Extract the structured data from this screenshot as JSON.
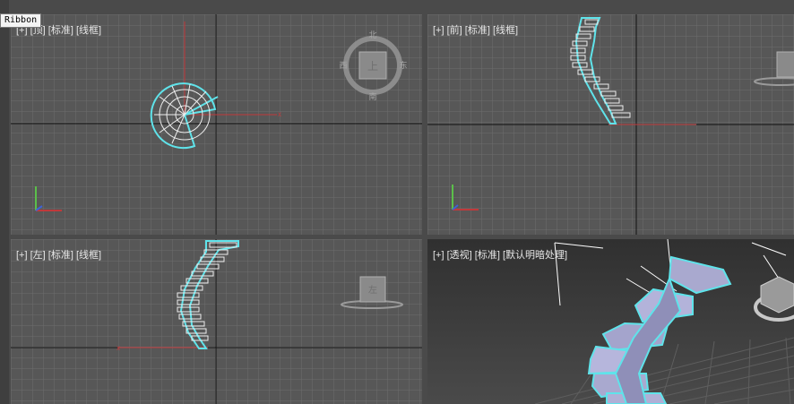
{
  "tooltip": {
    "text": "Ribbon"
  },
  "viewports": {
    "top": {
      "plus": "[+]",
      "view": "[顶]",
      "shading": "[标准]",
      "mode": "[线框]"
    },
    "front": {
      "plus": "[+]",
      "view": "[前]",
      "shading": "[标准]",
      "mode": "[线框]"
    },
    "left": {
      "plus": "[+]",
      "view": "[左]",
      "shading": "[标准]",
      "mode": "[线框]"
    },
    "persp": {
      "plus": "[+]",
      "view": "[透视]",
      "shading": "[标准]",
      "mode": "[默认明暗处理]"
    }
  },
  "viewcube": {
    "top": {
      "face": "上",
      "north": "北",
      "south": "南",
      "east": "东",
      "west": "西"
    },
    "left_face": "左"
  },
  "colors": {
    "viewport_bg": "#575757",
    "grid": "#6b6b6b",
    "axis_x": "#c0393b",
    "axis_y": "#c0393b",
    "selection": "#5fe3ea",
    "active_border": "#c6a24a",
    "label": "#e6e6e6"
  }
}
